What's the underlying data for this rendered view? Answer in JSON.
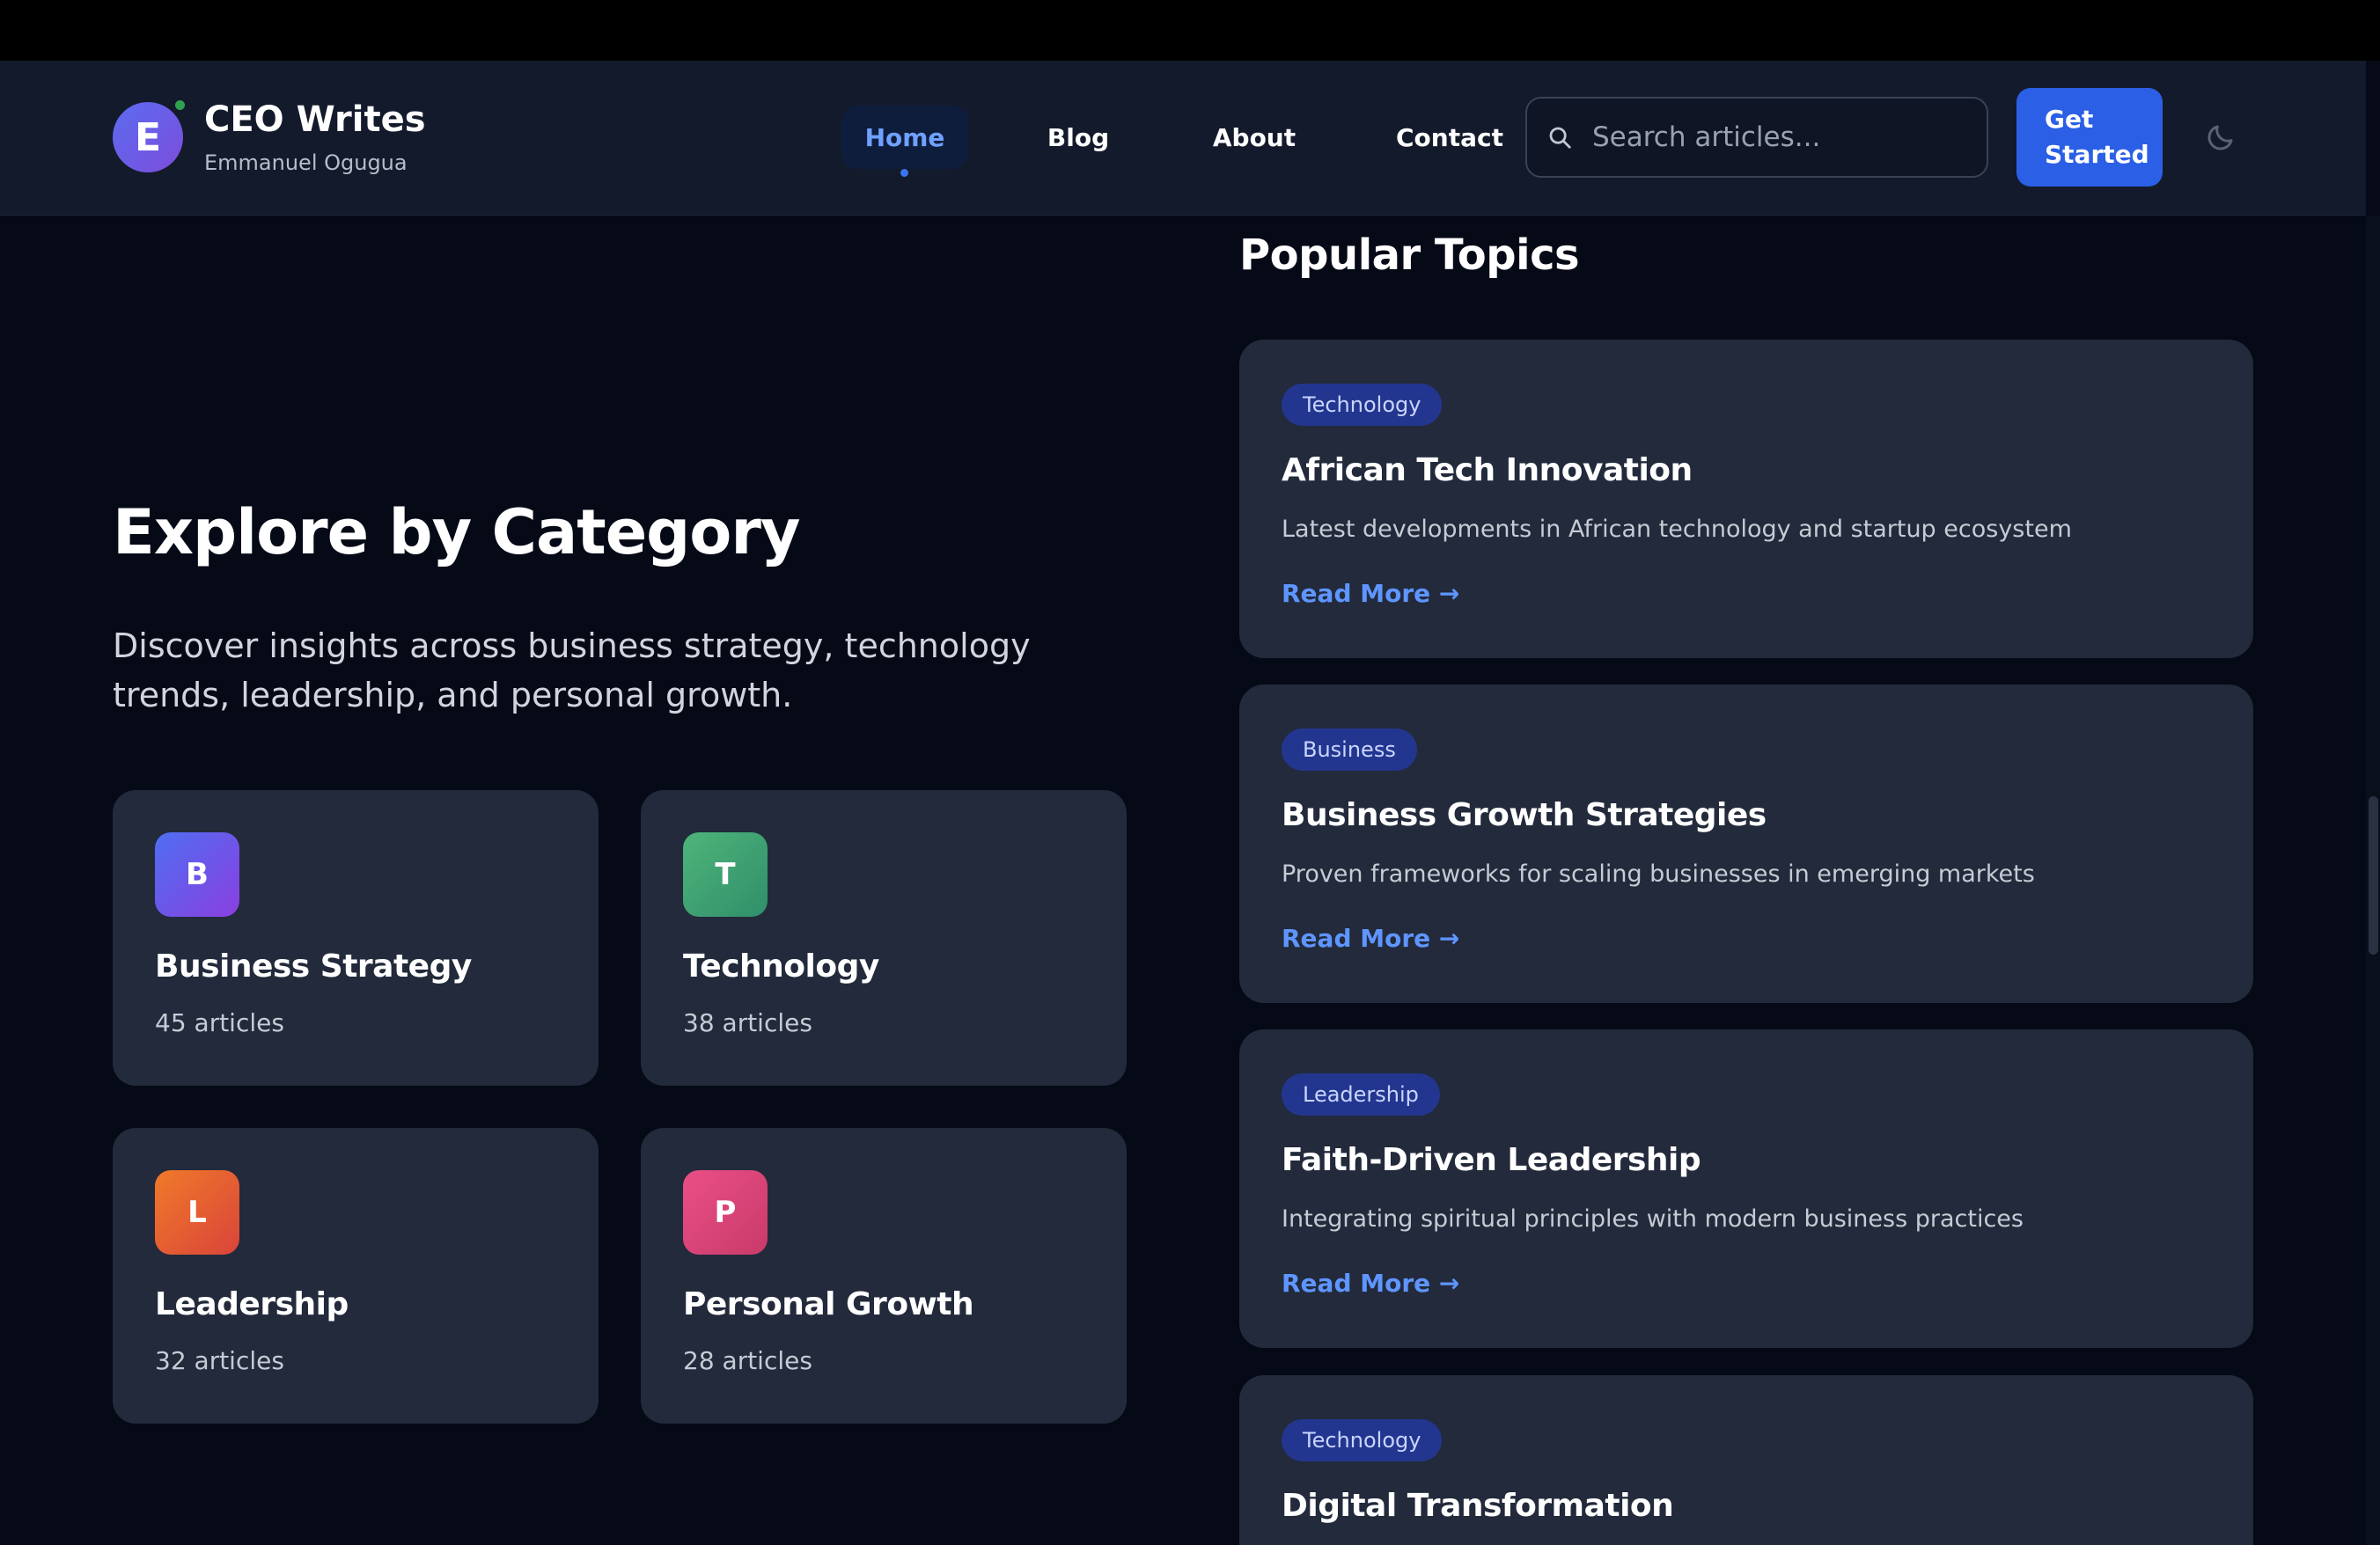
{
  "brand": {
    "logo_letter": "E",
    "title": "CEO Writes",
    "subtitle": "Emmanuel Ogugua"
  },
  "nav": {
    "items": [
      {
        "label": "Home",
        "active": true
      },
      {
        "label": "Blog",
        "active": false
      },
      {
        "label": "About",
        "active": false
      },
      {
        "label": "Contact",
        "active": false
      }
    ]
  },
  "search": {
    "placeholder": "Search articles...",
    "value": "",
    "icon": "search-icon"
  },
  "cta": {
    "label": "Get Started"
  },
  "theme_toggle": {
    "icon": "moon-icon"
  },
  "categories_section": {
    "title": "Explore by Category",
    "description": "Discover insights across business strategy, technology trends, leadership, and personal growth.",
    "items": [
      {
        "letter": "B",
        "name": "Business Strategy",
        "count": "45 articles",
        "color": "#6a5af0"
      },
      {
        "letter": "T",
        "name": "Technology",
        "count": "38 articles",
        "color": "#3fa874"
      },
      {
        "letter": "L",
        "name": "Leadership",
        "count": "32 articles",
        "color": "#ea6a2f"
      },
      {
        "letter": "P",
        "name": "Personal Growth",
        "count": "28 articles",
        "color": "#e04b7f"
      }
    ]
  },
  "popular": {
    "title": "Popular Topics",
    "items": [
      {
        "tag": "Technology",
        "title": "African Tech Innovation",
        "description": "Latest developments in African technology and startup ecosystem",
        "link": "Read More →"
      },
      {
        "tag": "Business",
        "title": "Business Growth Strategies",
        "description": "Proven frameworks for scaling businesses in emerging markets",
        "link": "Read More →"
      },
      {
        "tag": "Leadership",
        "title": "Faith-Driven Leadership",
        "description": "Integrating spiritual principles with modern business practices",
        "link": "Read More →"
      },
      {
        "tag": "Technology",
        "title": "Digital Transformation",
        "description": "",
        "link": ""
      }
    ]
  },
  "colors": {
    "accent": "#2b5fe6",
    "link": "#5f95ff",
    "card_bg": "#222a3b",
    "page_bg": "#060a17"
  }
}
